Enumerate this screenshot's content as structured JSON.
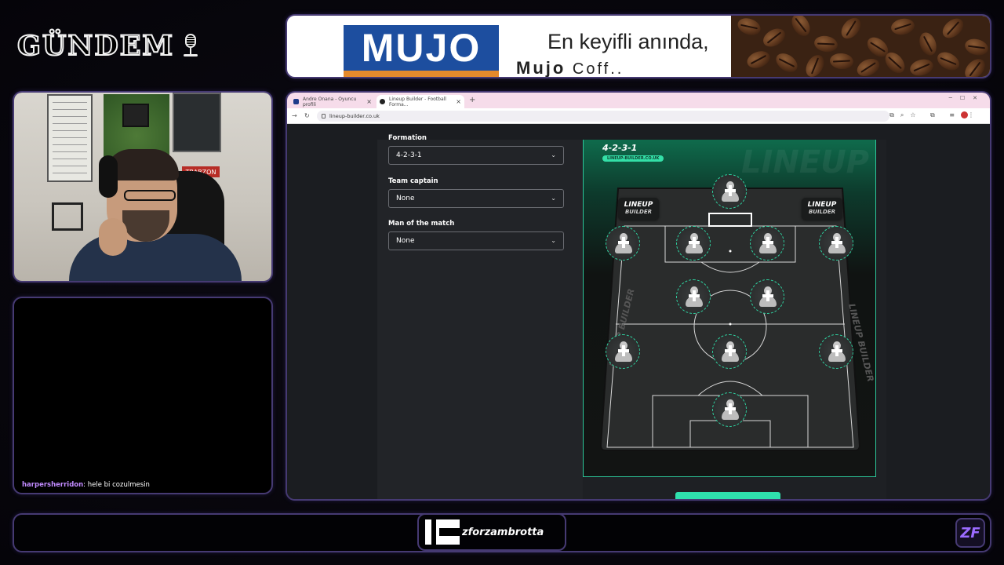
{
  "brand": {
    "title": "GÜNDEM"
  },
  "ad": {
    "logo_text": "MUJO",
    "slogan": "En keyifli anında,",
    "brand_line_bold": "Mujo",
    "brand_line_rest": " Coff..",
    "colors": {
      "logo_bg": "#1d4e9f",
      "logo_stripe": "#e58a2c"
    }
  },
  "camera": {
    "sign_text": "TRABZON"
  },
  "chat": {
    "messages": [
      {
        "user": "harpersherridon",
        "text": ": hele bi cozulmesin"
      }
    ]
  },
  "browser": {
    "tabs": [
      {
        "label": "Andre Onana - Oyuncu profili",
        "active": false
      },
      {
        "label": "Lineup Builder - Football Forma...",
        "active": true
      }
    ],
    "url": "lineup-builder.co.uk"
  },
  "form": {
    "formation_label": "Formation",
    "formation_value": "4-2-3-1",
    "captain_label": "Team captain",
    "captain_value": "None",
    "motm_label": "Man of the match",
    "motm_value": "None"
  },
  "pitch": {
    "formation": "4-2-3-1",
    "site": "LINEUP-BUILDER.CO.UK",
    "watermark": "LINEUP",
    "badge_line1": "LINEUP",
    "badge_line2": "BUILDER",
    "side_text": "LINEUP BUILDER",
    "accent_color": "#2fd6a3"
  },
  "bottom": {
    "channel": "zforzambrotta",
    "corner_logo": "ZF"
  }
}
